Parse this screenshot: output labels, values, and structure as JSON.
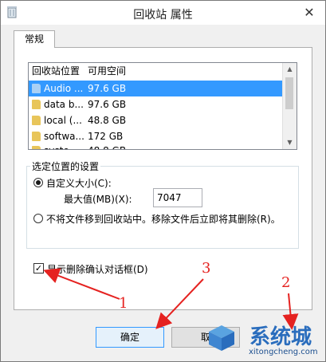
{
  "window": {
    "title": "回收站 属性",
    "close_glyph": "✕"
  },
  "tabs": [
    {
      "label": "常规"
    }
  ],
  "list": {
    "headers": {
      "location": "回收站位置",
      "free_space": "可用空间"
    },
    "rows": [
      {
        "name": "Audio ...",
        "size": "97.6 GB",
        "selected": true
      },
      {
        "name": "data b...",
        "size": "97.6 GB",
        "selected": false
      },
      {
        "name": "local (...",
        "size": "48.8 GB",
        "selected": false
      },
      {
        "name": "softwa...",
        "size": "172 GB",
        "selected": false
      },
      {
        "name": "syste...",
        "size": "48.8 GB",
        "selected": false
      }
    ]
  },
  "settings": {
    "group_title": "选定位置的设置",
    "custom_size_label": "自定义大小(C):",
    "max_value_label": "最大值(MB)(X):",
    "max_value": "7047",
    "no_move_label": "不将文件移到回收站中。移除文件后立即将其删除(R)。",
    "confirm_delete_label": "显示删除确认对话框(D)",
    "confirm_delete_checked": true
  },
  "buttons": {
    "ok": "确定",
    "cancel": "取"
  },
  "annotations": {
    "n1": "1",
    "n2": "2",
    "n3": "3",
    "color": "#e52220"
  },
  "watermark": {
    "text": "系统城",
    "url": "xitongcheng.com"
  }
}
